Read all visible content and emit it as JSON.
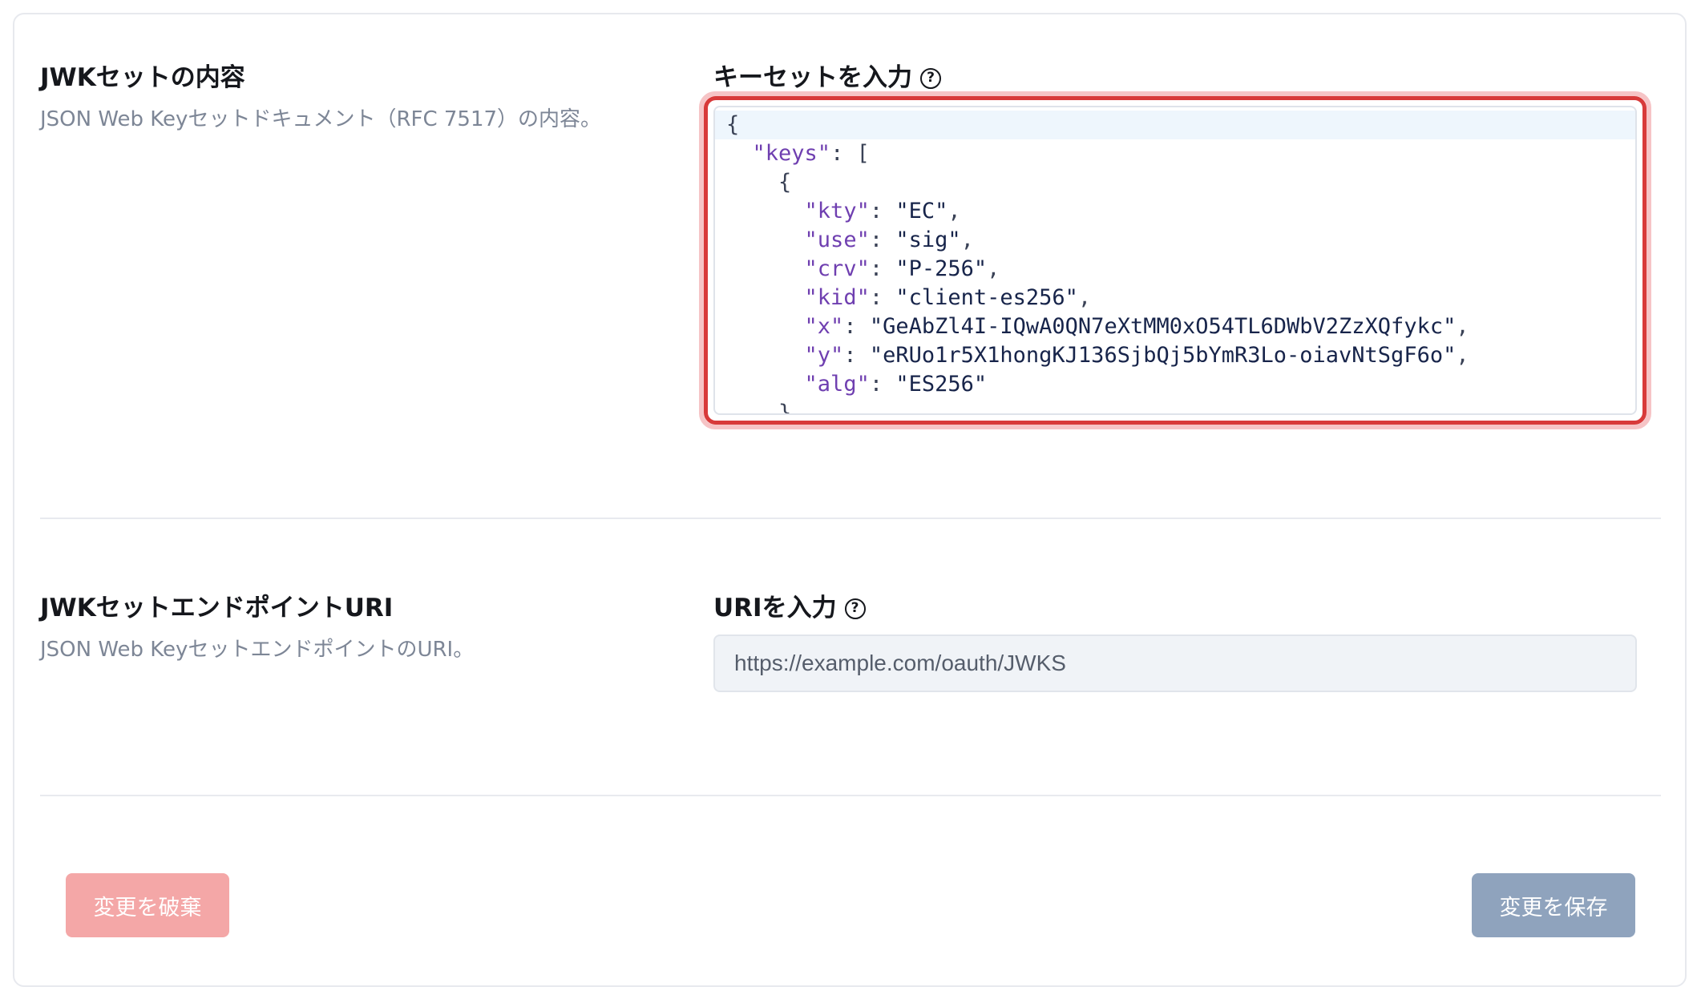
{
  "jwk_set_content": {
    "title": "JWKセットの内容",
    "description": "JSON Web Keyセットドキュメント（RFC 7517）の内容。",
    "field_label": "キーセットを入力",
    "help_icon": "question-circle-icon",
    "code_lines": [
      [
        {
          "t": "p",
          "v": "{"
        }
      ],
      [
        {
          "t": "p",
          "v": "  "
        },
        {
          "t": "k",
          "v": "\"keys\""
        },
        {
          "t": "p",
          "v": ": ["
        }
      ],
      [
        {
          "t": "p",
          "v": "    {"
        }
      ],
      [
        {
          "t": "p",
          "v": "      "
        },
        {
          "t": "k",
          "v": "\"kty\""
        },
        {
          "t": "p",
          "v": ": "
        },
        {
          "t": "s",
          "v": "\"EC\""
        },
        {
          "t": "p",
          "v": ","
        }
      ],
      [
        {
          "t": "p",
          "v": "      "
        },
        {
          "t": "k",
          "v": "\"use\""
        },
        {
          "t": "p",
          "v": ": "
        },
        {
          "t": "s",
          "v": "\"sig\""
        },
        {
          "t": "p",
          "v": ","
        }
      ],
      [
        {
          "t": "p",
          "v": "      "
        },
        {
          "t": "k",
          "v": "\"crv\""
        },
        {
          "t": "p",
          "v": ": "
        },
        {
          "t": "s",
          "v": "\"P-256\""
        },
        {
          "t": "p",
          "v": ","
        }
      ],
      [
        {
          "t": "p",
          "v": "      "
        },
        {
          "t": "k",
          "v": "\"kid\""
        },
        {
          "t": "p",
          "v": ": "
        },
        {
          "t": "s",
          "v": "\"client-es256\""
        },
        {
          "t": "p",
          "v": ","
        }
      ],
      [
        {
          "t": "p",
          "v": "      "
        },
        {
          "t": "k",
          "v": "\"x\""
        },
        {
          "t": "p",
          "v": ": "
        },
        {
          "t": "s",
          "v": "\"GeAbZl4I-IQwA0QN7eXtMM0xO54TL6DWbV2ZzXQfykc\""
        },
        {
          "t": "p",
          "v": ","
        }
      ],
      [
        {
          "t": "p",
          "v": "      "
        },
        {
          "t": "k",
          "v": "\"y\""
        },
        {
          "t": "p",
          "v": ": "
        },
        {
          "t": "s",
          "v": "\"eRUo1r5X1hongKJ136SjbQj5bYmR3Lo-oiavNtSgF6o\""
        },
        {
          "t": "p",
          "v": ","
        }
      ],
      [
        {
          "t": "p",
          "v": "      "
        },
        {
          "t": "k",
          "v": "\"alg\""
        },
        {
          "t": "p",
          "v": ": "
        },
        {
          "t": "s",
          "v": "\"ES256\""
        }
      ],
      [
        {
          "t": "p",
          "v": "    }"
        }
      ]
    ]
  },
  "jwk_set_endpoint": {
    "title": "JWKセットエンドポイントURI",
    "description": "JSON Web KeyセットエンドポイントのURI。",
    "field_label": "URIを入力",
    "help_icon": "question-circle-icon",
    "placeholder": "https://example.com/oauth/JWKS"
  },
  "actions": {
    "discard_label": "変更を破棄",
    "save_label": "変更を保存"
  },
  "colors": {
    "focus_border": "#d83a3a",
    "discard_button": "#f4a7a7",
    "save_button": "#8fa3bd",
    "json_key": "#6f3fb0"
  }
}
